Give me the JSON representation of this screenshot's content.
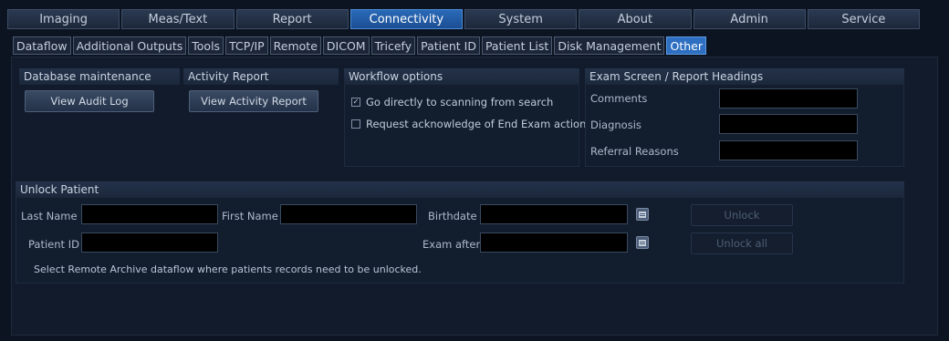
{
  "main_tabs": [
    "Imaging",
    "Meas/Text",
    "Report",
    "Connectivity",
    "System",
    "About",
    "Admin",
    "Service"
  ],
  "main_tab_active": "Connectivity",
  "sub_tabs": [
    "Dataflow",
    "Additional Outputs",
    "Tools",
    "TCP/IP",
    "Remote",
    "DICOM",
    "Tricefy",
    "Patient ID",
    "Patient List",
    "Disk Management",
    "Other"
  ],
  "sub_tab_active": "Other",
  "database": {
    "title": "Database maintenance",
    "button": "View Audit Log"
  },
  "activity": {
    "title": "Activity Report",
    "button": "View Activity Report"
  },
  "workflow": {
    "title": "Workflow options",
    "options": [
      {
        "label": "Go directly to scanning from search",
        "checked": true,
        "mark": "✓"
      },
      {
        "label": "Request acknowledge of End Exam action",
        "checked": false,
        "mark": ""
      }
    ]
  },
  "headings": {
    "title": "Exam Screen / Report Headings",
    "comments_label": "Comments",
    "diagnosis_label": "Diagnosis",
    "referral_label": "Referral Reasons",
    "comments_value": "",
    "diagnosis_value": "",
    "referral_value": ""
  },
  "unlock": {
    "title": "Unlock Patient",
    "last_name_label": "Last Name",
    "first_name_label": "First Name",
    "birthdate_label": "Birthdate",
    "patient_id_label": "Patient ID",
    "exam_after_label": "Exam after",
    "last_name_value": "",
    "first_name_value": "",
    "birthdate_value": "",
    "patient_id_value": "",
    "exam_after_value": "",
    "unlock_button": "Unlock",
    "unlock_all_button": "Unlock all",
    "note": "Select Remote Archive dataflow where patients records need to be unlocked."
  },
  "colors": {
    "accent": "#2a6ab8",
    "background": "#0c1421",
    "field": "#000000"
  }
}
